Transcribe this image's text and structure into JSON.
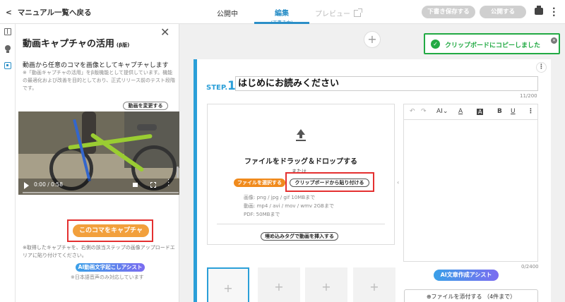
{
  "topbar": {
    "back_label": "マニュアル一覧へ戻る",
    "tab_published": "公開中",
    "tab_edit": "編集",
    "tab_edit_sub": "(下書き中)",
    "tab_preview": "プレビュー",
    "save_draft": "下書き保存する",
    "publish": "公開する"
  },
  "panel": {
    "title": "動画キャプチャの活用",
    "beta": "(β版)",
    "description": "動画から任意のコマを画像としてキャプチャします",
    "note": "※「動画キャプチャの活用」をβ版機能として提供しています。機能の最適化および改善を目的としており、正式リリース前のテスト段階です。",
    "change_video": "動画を変更する",
    "video_time": "0:00 / 0:58",
    "capture_button": "このコマをキャプチャ",
    "capture_note": "※取得したキャプチャを、右側の該当ステップの画像アップロードエリアに貼り付けてください。",
    "ai_transcribe": "AI動画文字起こしアシスト",
    "ai_transcribe_note": "※日本語音声のみ対応しています"
  },
  "toast": {
    "message": "クリップボードにコピーしました"
  },
  "step": {
    "label": "STEP.",
    "number": "1",
    "title": "はじめにお読みください",
    "title_counter": "11/200"
  },
  "upload": {
    "drop_title": "ファイルをドラッグ＆ドロップする",
    "or": "または",
    "select_file": "ファイルを選択する",
    "paste_clipboard": "クリップボードから貼り付ける",
    "format_image": "画像: png / jpg / gif 10MBまで",
    "format_video": "動画: mp4 / avi / mov / wmv 2GBまで",
    "format_pdf": "PDF: 50MBまで",
    "embed_video": "埋め込みタグで動画を挿入する"
  },
  "editor": {
    "ai_label": "AI",
    "font_color_label": "A",
    "highlight_label": "A",
    "bold_label": "B",
    "underline_label": "U",
    "text_counter": "0/2400",
    "ai_write": "AI文章作成アシスト",
    "attach": "⊕ファイルを添付する （4件まで）"
  },
  "thumbnails": [
    "+",
    "+",
    "+",
    "+"
  ],
  "colors": {
    "accent": "#2b9fd8",
    "capture_orange": "#f2a03c",
    "toast_green": "#22aa44",
    "highlight_red": "#e43030"
  }
}
